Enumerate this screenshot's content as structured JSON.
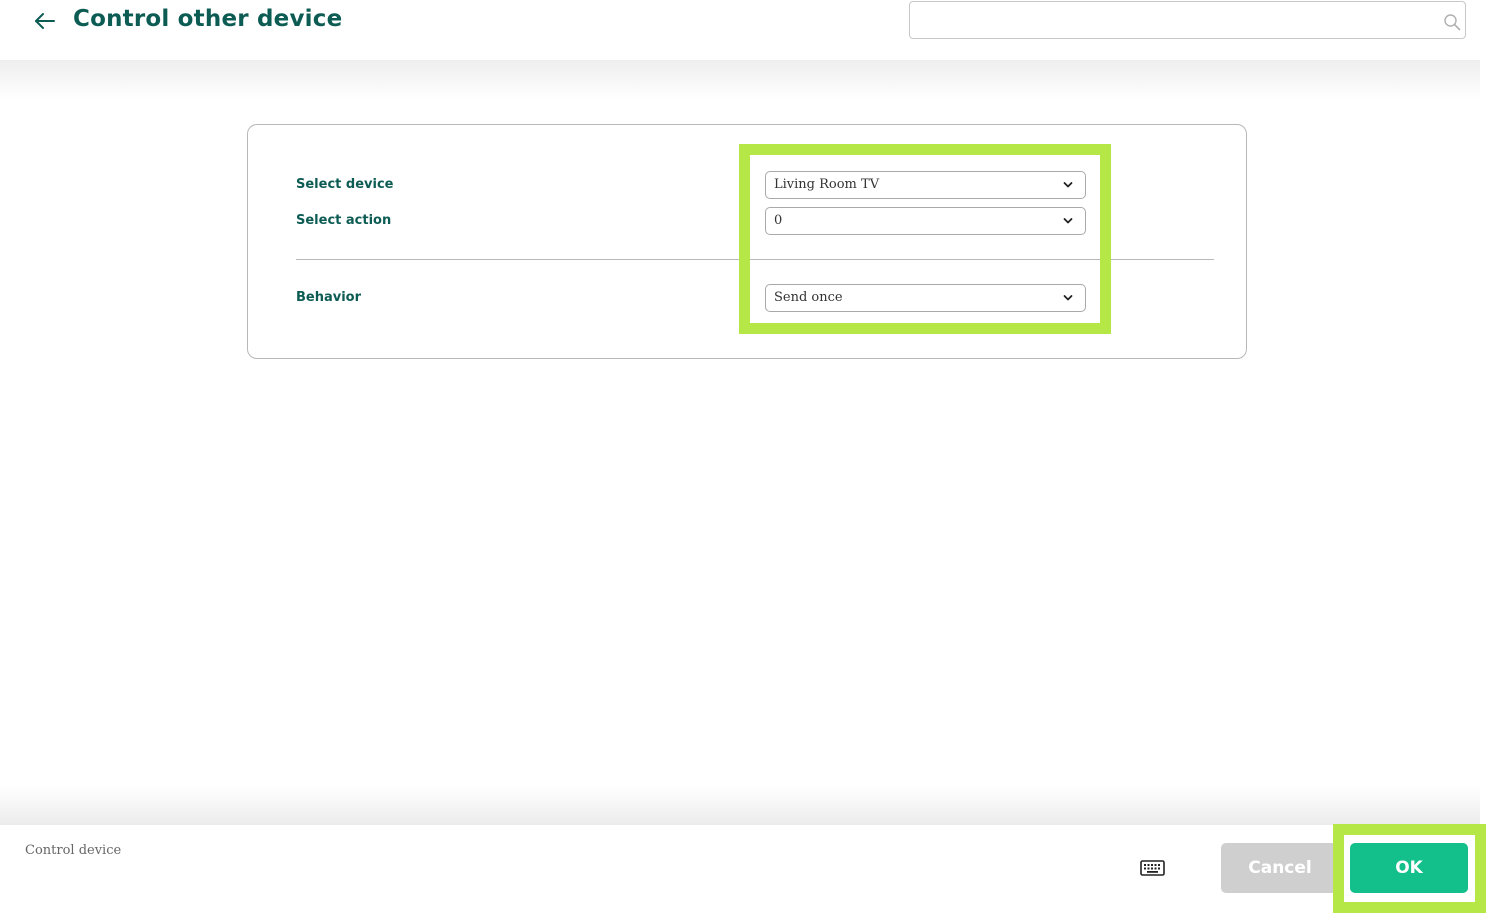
{
  "header": {
    "title": "Control other device",
    "back_icon": "arrow-left-icon",
    "search": {
      "value": "",
      "placeholder": "",
      "icon": "search-icon"
    }
  },
  "form": {
    "fields": [
      {
        "label": "Select device",
        "value": "Living Room TV"
      },
      {
        "label": "Select action",
        "value": "0"
      },
      {
        "label": "Behavior",
        "value": "Send once"
      }
    ],
    "chevron_icon": "chevron-down-icon"
  },
  "footer": {
    "label": "Control device",
    "keyboard_icon": "keyboard-icon",
    "cancel_label": "Cancel",
    "ok_label": "OK"
  },
  "colors": {
    "accent": "#0d5c54",
    "ok_button": "#13bf8a",
    "cancel_button": "#cfcfcf",
    "highlight": "#b5e846"
  }
}
